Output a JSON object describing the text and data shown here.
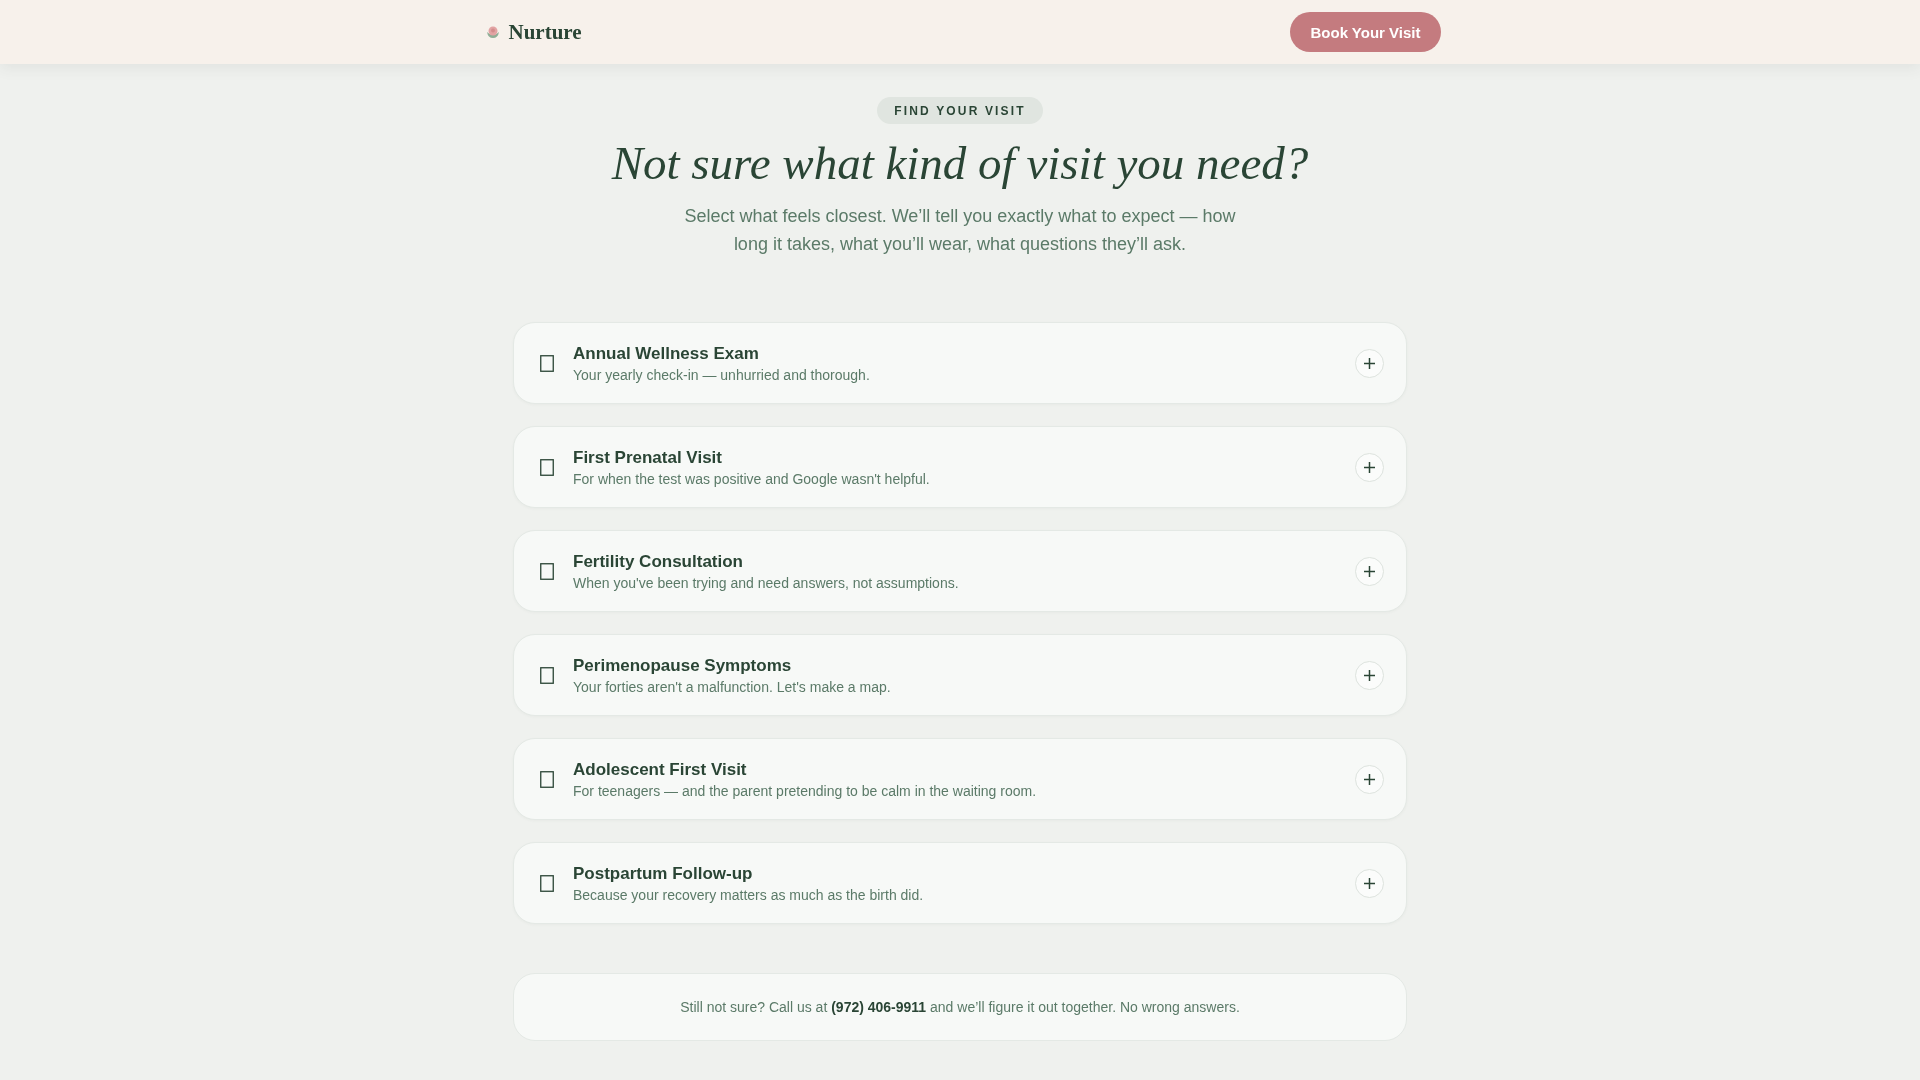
{
  "header": {
    "brand": "Nurture",
    "button": "Book Your Visit"
  },
  "hero": {
    "eyebrow": "FIND YOUR VISIT",
    "title": "Not sure what kind of visit you need?",
    "subtitle": "Select what feels closest. We’ll tell you exactly what to expect — how long it takes, what you’ll wear, what questions they’ll ask."
  },
  "visits": [
    {
      "title": "Annual Wellness Exam",
      "description": "Your yearly check-in — unhurried and thorough.",
      "expanded": false
    },
    {
      "title": "First Prenatal Visit",
      "description": "For when the test was positive and Google wasn't helpful.",
      "expanded": false
    },
    {
      "title": "Fertility Consultation",
      "description": "When you've been trying and need answers, not assumptions.",
      "expanded": false
    },
    {
      "title": "Perimenopause Symptoms",
      "description": "Your forties aren't a malfunction. Let's make a map.",
      "expanded": false
    },
    {
      "title": "Adolescent First Visit",
      "description": "For teenagers — and the parent pretending to be calm in the waiting room.",
      "expanded": false
    },
    {
      "title": "Postpartum Follow-up",
      "description": "Because your recovery matters as much as the birth did.",
      "expanded": false
    }
  ],
  "footer_note": "Still not sure? Call us at **(972) 406-9911** and we’ll figure it out together. No wrong answers."
}
